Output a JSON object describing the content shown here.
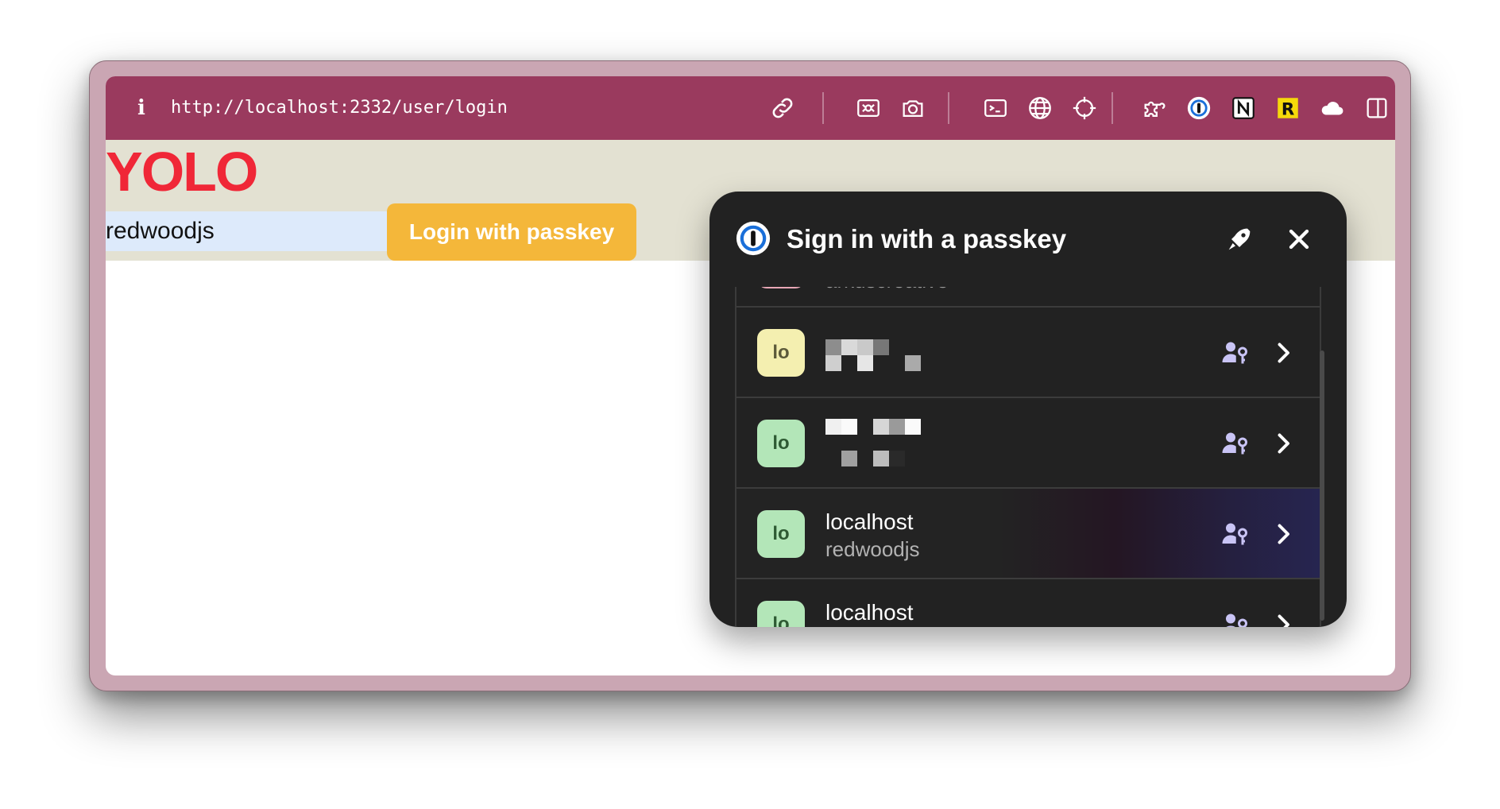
{
  "browser": {
    "url": "http://localhost:2332/user/login",
    "toolbar_icons": [
      "info-icon",
      "link-icon",
      "photo-frame-icon",
      "camera-icon",
      "terminal-icon",
      "globe-icon",
      "crosshair-icon",
      "puzzle-icon",
      "1password-icon",
      "notion-icon",
      "r-extension-icon",
      "cloud-icon",
      "sidebar-icon"
    ],
    "toolbar_color": "#9a3a5e"
  },
  "page": {
    "heading": "YOLO",
    "username_value": "redwoodjs",
    "login_button": "Login with passkey",
    "accent_red": "#f02737",
    "button_color": "#f4b73a"
  },
  "popup": {
    "title": "Sign in with a passkey",
    "partial_top_row_sub": "arkuscreative",
    "rows": [
      {
        "avatar": "lo",
        "avatar_color": "#f4efb0",
        "title": "",
        "subtitle": "",
        "redacted": true
      },
      {
        "avatar": "lo",
        "avatar_color": "#b3e6b8",
        "title": "",
        "subtitle": "",
        "redacted": true
      },
      {
        "avatar": "lo",
        "avatar_color": "#b3e6b8",
        "title": "localhost",
        "subtitle": "redwoodjs",
        "redacted": false
      },
      {
        "avatar": "lo",
        "avatar_color": "#b3e6b8",
        "title": "localhost",
        "subtitle": "",
        "redacted": false
      }
    ]
  }
}
